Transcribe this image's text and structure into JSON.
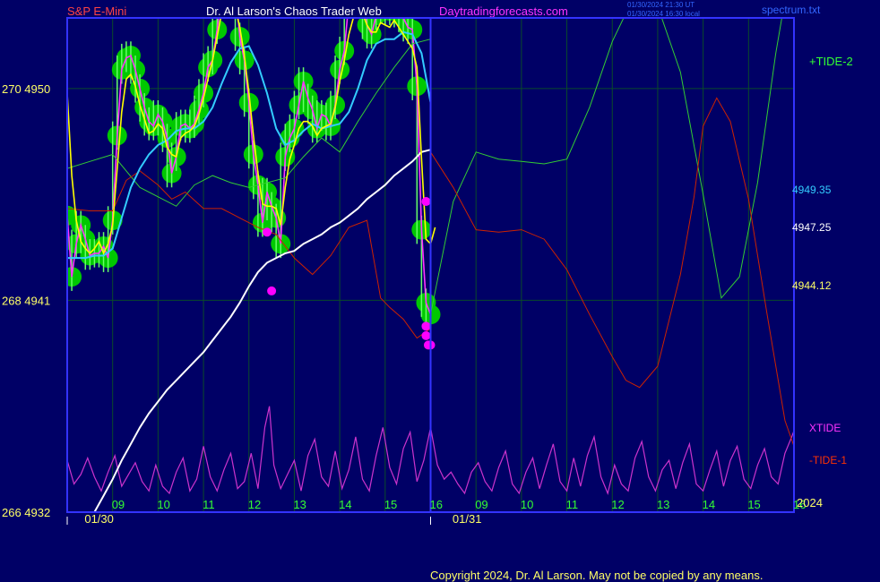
{
  "header": {
    "instrument": "S&P E-Mini",
    "site": "Dr. Al Larson's Chaos Trader Web",
    "url": "Daytradingforecasts.com",
    "stamp1": "01/30/2024 21:30 UT",
    "stamp2": "01/30/2024 16:30 local",
    "file": "spectrum.txt"
  },
  "footer": {
    "copyright": "Copyright 2024, Dr. Al Larson. May not be copied by any means."
  },
  "colors": {
    "background": "#000066",
    "frame": "#3333ff",
    "grid": "#0a4a2a",
    "price_glow": "#00c800",
    "price_bars": "#66ff66",
    "dots_green": "#00ff00",
    "dots_magenta": "#ff00ff",
    "fast_ma": "#ffff00",
    "cyan_ma": "#33ccff",
    "slow_ma": "#ffffff",
    "tide_plus": "#33cc33",
    "tide_minus": "#cc2200",
    "xtide": "#cc33cc",
    "magenta_line": "#ff33ff"
  },
  "chart_data": {
    "type": "line",
    "y_axis": {
      "range": [
        4932,
        4953
      ],
      "ticks": [
        {
          "value": 4950,
          "label": "270  4950"
        },
        {
          "value": 4941,
          "label": "268  4941"
        },
        {
          "value": 4932,
          "label": "266  4932"
        }
      ]
    },
    "x_axis": {
      "range": [
        8.0,
        24.0
      ],
      "hour_ticks": [
        {
          "x": 9,
          "label": "09"
        },
        {
          "x": 10,
          "label": "10"
        },
        {
          "x": 11,
          "label": "11"
        },
        {
          "x": 12,
          "label": "12"
        },
        {
          "x": 13,
          "label": "13"
        },
        {
          "x": 14,
          "label": "14"
        },
        {
          "x": 15,
          "label": "15"
        },
        {
          "x": 16,
          "label": "16"
        },
        {
          "x": 17,
          "label": "09"
        },
        {
          "x": 18,
          "label": "10"
        },
        {
          "x": 19,
          "label": "11"
        },
        {
          "x": 20,
          "label": "12"
        },
        {
          "x": 21,
          "label": "13"
        },
        {
          "x": 22,
          "label": "14"
        },
        {
          "x": 23,
          "label": "15"
        },
        {
          "x": 24,
          "label": "16"
        }
      ],
      "date_labels": [
        {
          "x": 8.5,
          "label": "01/30"
        },
        {
          "x": 16.6,
          "label": "01/31"
        }
      ],
      "year_label": "2024",
      "now_x": 16.0
    },
    "labels": {
      "tide_plus": "+TIDE-2",
      "tide_minus": "-TIDE-1",
      "xtide": "XTIDE",
      "value_cyan": "4949.35",
      "value_white": "4947.25",
      "value_yellow": "4944.12"
    },
    "price": {
      "x": [
        8.0,
        8.1,
        8.2,
        8.3,
        8.4,
        8.5,
        8.6,
        8.7,
        8.8,
        8.9,
        9.0,
        9.1,
        9.2,
        9.3,
        9.4,
        9.5,
        9.6,
        9.7,
        9.8,
        9.9,
        10.0,
        10.1,
        10.2,
        10.3,
        10.4,
        10.5,
        10.6,
        10.7,
        10.8,
        10.9,
        11.0,
        11.1,
        11.2,
        11.3,
        11.4,
        11.5,
        11.6,
        11.7,
        11.8,
        11.9,
        12.0,
        12.1,
        12.2,
        12.3,
        12.4,
        12.5,
        12.6,
        12.7,
        12.8,
        12.9,
        13.0,
        13.1,
        13.2,
        13.3,
        13.4,
        13.5,
        13.6,
        13.7,
        13.8,
        13.9,
        14.0,
        14.1,
        14.2,
        14.3,
        14.4,
        14.5,
        14.6,
        14.7,
        14.8,
        14.9,
        15.0,
        15.1,
        15.2,
        15.3,
        15.4,
        15.5,
        15.6,
        15.7,
        15.8,
        15.9,
        16.0
      ],
      "values": [
        4944.6,
        4942.0,
        4943.4,
        4944.2,
        4943.6,
        4942.9,
        4943.0,
        4943.0,
        4943.3,
        4942.8,
        4944.4,
        4948.0,
        4950.8,
        4951.3,
        4951.4,
        4950.8,
        4950.0,
        4949.2,
        4948.6,
        4948.4,
        4948.9,
        4948.6,
        4947.9,
        4946.4,
        4947.1,
        4948.4,
        4948.5,
        4948.3,
        4948.5,
        4949.1,
        4949.8,
        4950.9,
        4951.2,
        4952.5,
        4954.1,
        4954.7,
        4954.4,
        4954.3,
        4952.2,
        4951.2,
        4949.4,
        4947.2,
        4945.9,
        4944.3,
        4945.6,
        4945.0,
        4944.5,
        4943.4,
        4947.1,
        4947.9,
        4948.3,
        4949.3,
        4950.3,
        4949.6,
        4949.1,
        4948.3,
        4948.9,
        4948.8,
        4948.4,
        4949.3,
        4950.8,
        4951.6,
        4953.7,
        4954.2,
        4953.8,
        4953.6,
        4952.7,
        4952.3,
        4953.1,
        4953.4,
        4953.4,
        4953.3,
        4953.5,
        4953.2,
        4953.0,
        4952.6,
        4952.5,
        4950.1,
        4944.0,
        4940.9,
        4940.4
      ]
    },
    "fast_ma": {
      "x": [
        8.0,
        8.1,
        8.2,
        8.3,
        8.4,
        8.5,
        8.6,
        8.7,
        8.8,
        8.9,
        9.0,
        9.1,
        9.2,
        9.3,
        9.4,
        9.5,
        9.6,
        9.7,
        9.8,
        9.9,
        10.0,
        10.1,
        10.2,
        10.3,
        10.4,
        10.5,
        10.6,
        10.7,
        10.8,
        10.9,
        11.0,
        11.1,
        11.2,
        11.3,
        11.4,
        11.5,
        11.6,
        11.7,
        11.8,
        11.9,
        12.0,
        12.1,
        12.2,
        12.3,
        12.4,
        12.5,
        12.6,
        12.7,
        12.8,
        12.9,
        13.0,
        13.1,
        13.2,
        13.3,
        13.4,
        13.5,
        13.6,
        13.7,
        13.8,
        13.9,
        14.0,
        14.1,
        14.2,
        14.3,
        14.4,
        14.5,
        14.6,
        14.7,
        14.8,
        14.9,
        15.0,
        15.1,
        15.2,
        15.3,
        15.4,
        15.5,
        15.6,
        15.7,
        15.8,
        15.9,
        16.0,
        16.1
      ],
      "values": [
        4949.8,
        4946.3,
        4944.4,
        4943.5,
        4943.2,
        4943.0,
        4943.2,
        4943.5,
        4943.0,
        4943.4,
        4944.2,
        4946.6,
        4949.0,
        4950.4,
        4950.6,
        4950.1,
        4949.3,
        4948.7,
        4948.1,
        4948.2,
        4948.5,
        4948.3,
        4947.5,
        4947.2,
        4947.1,
        4947.9,
        4948.1,
        4948.2,
        4948.4,
        4948.9,
        4949.6,
        4950.4,
        4951.2,
        4952.2,
        4953.2,
        4953.6,
        4953.9,
        4953.4,
        4952.6,
        4951.4,
        4949.8,
        4948.0,
        4946.4,
        4945.1,
        4945.0,
        4945.0,
        4944.9,
        4944.2,
        4945.8,
        4947.0,
        4947.6,
        4948.3,
        4948.6,
        4948.6,
        4948.4,
        4948.0,
        4948.3,
        4948.4,
        4948.5,
        4949.2,
        4950.3,
        4951.2,
        4952.3,
        4953.0,
        4953.1,
        4953.2,
        4952.7,
        4952.4,
        4952.4,
        4952.8,
        4952.7,
        4952.6,
        4952.9,
        4952.6,
        4952.3,
        4952.0,
        4951.7,
        4950.9,
        4947.0,
        4943.6,
        4943.4,
        4944.1
      ]
    },
    "cyan_ma": {
      "x": [
        8.0,
        8.2,
        8.4,
        8.6,
        8.8,
        9.0,
        9.2,
        9.4,
        9.6,
        9.8,
        10.0,
        10.2,
        10.4,
        10.6,
        10.8,
        11.0,
        11.2,
        11.4,
        11.6,
        11.8,
        12.0,
        12.2,
        12.4,
        12.6,
        12.8,
        13.0,
        13.2,
        13.4,
        13.6,
        13.8,
        14.0,
        14.2,
        14.4,
        14.6,
        14.8,
        15.0,
        15.2,
        15.4,
        15.6,
        15.8,
        16.0
      ],
      "values": [
        4942.8,
        4942.8,
        4942.8,
        4942.9,
        4942.9,
        4943.2,
        4944.5,
        4945.8,
        4946.6,
        4947.2,
        4947.6,
        4947.8,
        4948.2,
        4948.3,
        4948.3,
        4948.6,
        4949.2,
        4950.2,
        4951.1,
        4951.7,
        4951.8,
        4951.0,
        4949.8,
        4948.3,
        4947.6,
        4947.8,
        4948.2,
        4948.5,
        4948.3,
        4948.4,
        4948.5,
        4949.0,
        4950.0,
        4951.2,
        4951.9,
        4952.1,
        4952.1,
        4952.4,
        4952.3,
        4951.5,
        4949.4
      ]
    },
    "slow_ma": {
      "x": [
        8.6,
        8.8,
        9.0,
        9.2,
        9.4,
        9.6,
        9.8,
        10.0,
        10.2,
        10.4,
        10.6,
        10.8,
        11.0,
        11.2,
        11.4,
        11.6,
        11.8,
        12.0,
        12.2,
        12.4,
        12.6,
        12.8,
        13.0,
        13.2,
        13.4,
        13.6,
        13.8,
        14.0,
        14.2,
        14.4,
        14.6,
        14.8,
        15.0,
        15.2,
        15.4,
        15.6,
        15.8,
        16.0
      ],
      "values": [
        4932.0,
        4932.7,
        4933.4,
        4934.2,
        4934.9,
        4935.6,
        4936.2,
        4936.7,
        4937.2,
        4937.6,
        4938.0,
        4938.4,
        4938.8,
        4939.3,
        4939.8,
        4940.3,
        4940.9,
        4941.6,
        4942.2,
        4942.6,
        4942.8,
        4943.0,
        4943.1,
        4943.4,
        4943.6,
        4943.8,
        4944.1,
        4944.3,
        4944.6,
        4944.9,
        4945.3,
        4945.6,
        4945.9,
        4946.3,
        4946.6,
        4946.9,
        4947.3,
        4947.4
      ]
    },
    "dots": {
      "green": [
        {
          "x": 12.0,
          "y": 4954.6
        },
        {
          "x": 12.2,
          "y": 4954.6
        },
        {
          "x": 12.4,
          "y": 4954.6
        },
        {
          "x": 14.9,
          "y": 4954.7
        },
        {
          "x": 15.4,
          "y": 4954.6
        },
        {
          "x": 15.6,
          "y": 4955.9
        },
        {
          "x": 15.7,
          "y": 4957.2
        }
      ],
      "magenta": [
        {
          "x": 12.4,
          "y": 4943.9
        },
        {
          "x": 12.5,
          "y": 4941.4
        },
        {
          "x": 15.9,
          "y": 4945.2
        },
        {
          "x": 15.9,
          "y": 4939.9
        },
        {
          "x": 15.9,
          "y": 4939.5
        },
        {
          "x": 15.95,
          "y": 4939.1
        },
        {
          "x": 16.0,
          "y": 4939.1
        }
      ]
    },
    "green_line": {
      "x": [
        8.0,
        8.5,
        9.0,
        9.3,
        9.6,
        10.0,
        10.4,
        10.8,
        11.2,
        11.6,
        12.0,
        12.4,
        12.8,
        13.2,
        13.6,
        14.0,
        14.4,
        14.8,
        15.2,
        15.6,
        16.0
      ],
      "values": [
        4946.6,
        4946.9,
        4947.2,
        4946.5,
        4945.8,
        4945.4,
        4945.0,
        4945.9,
        4946.3,
        4946.0,
        4945.8,
        4946.0,
        4946.2,
        4947.1,
        4947.9,
        4947.3,
        4948.6,
        4949.8,
        4950.9,
        4951.9,
        4952.1
      ]
    },
    "red_line": {
      "x": [
        8.0,
        8.5,
        9.0,
        9.3,
        9.6,
        10.0,
        10.3,
        10.6,
        11.0,
        11.4,
        11.8,
        12.2,
        12.6,
        13.0,
        13.4,
        13.8,
        14.2,
        14.6,
        14.9,
        15.1,
        15.4,
        15.7,
        16.0
      ],
      "values": [
        4944.9,
        4944.8,
        4944.8,
        4946.1,
        4946.5,
        4945.9,
        4945.3,
        4945.6,
        4944.9,
        4944.9,
        4944.5,
        4944.1,
        4943.8,
        4942.8,
        4942.1,
        4942.9,
        4944.1,
        4944.4,
        4941.1,
        4940.7,
        4940.2,
        4939.4,
        4939.8
      ]
    },
    "tide_plus_line": {
      "x": [
        16.0,
        16.5,
        17.0,
        17.5,
        18.0,
        18.5,
        19.0,
        19.5,
        20.0,
        20.5,
        21.0,
        21.5,
        22.0,
        22.4,
        22.8,
        23.2,
        23.6,
        24.0,
        24.1
      ],
      "values": [
        4940.4,
        4945.2,
        4947.3,
        4947.0,
        4946.9,
        4946.8,
        4947.0,
        4949.2,
        4952.0,
        4954.0,
        4953.5,
        4950.7,
        4945.5,
        4941.1,
        4942.0,
        4946.0,
        4951.5,
        4956.0,
        4957.0
      ]
    },
    "tide_minus_line": {
      "x": [
        16.0,
        16.5,
        17.0,
        17.5,
        18.0,
        18.5,
        19.0,
        19.5,
        20.0,
        20.3,
        20.6,
        21.0,
        21.5,
        21.8,
        22.0,
        22.3,
        22.6,
        23.0,
        23.4,
        23.8,
        24.0,
        24.1
      ],
      "values": [
        4947.3,
        4945.8,
        4944.0,
        4943.9,
        4944.0,
        4943.6,
        4942.3,
        4940.4,
        4938.6,
        4937.6,
        4937.3,
        4938.2,
        4942.1,
        4945.4,
        4948.4,
        4949.6,
        4948.6,
        4945.3,
        4940.5,
        4935.9,
        4934.8,
        4934.7
      ]
    },
    "xtide_line": {
      "x": [
        8.0,
        8.15,
        8.3,
        8.45,
        8.6,
        8.75,
        8.9,
        9.05,
        9.2,
        9.35,
        9.5,
        9.65,
        9.8,
        9.95,
        10.1,
        10.25,
        10.4,
        10.55,
        10.7,
        10.85,
        11.0,
        11.15,
        11.3,
        11.45,
        11.6,
        11.75,
        11.9,
        12.05,
        12.2,
        12.35,
        12.45,
        12.55,
        12.7,
        12.85,
        13.0,
        13.15,
        13.3,
        13.45,
        13.6,
        13.75,
        13.9,
        14.05,
        14.2,
        14.35,
        14.5,
        14.65,
        14.8,
        14.95,
        15.1,
        15.25,
        15.4,
        15.55,
        15.7,
        15.85,
        16.0,
        16.15,
        16.3,
        16.45,
        16.6,
        16.75,
        16.9,
        17.05,
        17.2,
        17.35,
        17.5,
        17.65,
        17.8,
        17.95,
        18.1,
        18.25,
        18.4,
        18.55,
        18.7,
        18.85,
        19.0,
        19.15,
        19.3,
        19.45,
        19.6,
        19.75,
        19.9,
        20.05,
        20.2,
        20.35,
        20.5,
        20.65,
        20.8,
        20.95,
        21.1,
        21.25,
        21.4,
        21.55,
        21.7,
        21.85,
        22.0,
        22.15,
        22.3,
        22.45,
        22.6,
        22.75,
        22.9,
        23.05,
        23.2,
        23.35,
        23.5,
        23.65,
        23.8,
        23.95,
        24.1
      ],
      "values": [
        4934.2,
        4933.2,
        4933.6,
        4934.3,
        4933.5,
        4932.9,
        4933.7,
        4934.4,
        4933.1,
        4933.6,
        4934.1,
        4933.3,
        4932.9,
        4934.0,
        4933.1,
        4932.8,
        4933.7,
        4934.3,
        4932.9,
        4933.4,
        4934.8,
        4933.5,
        4932.9,
        4933.8,
        4934.5,
        4933.0,
        4933.3,
        4934.5,
        4933.0,
        4935.6,
        4936.5,
        4934.0,
        4933.0,
        4933.6,
        4934.2,
        4932.9,
        4934.4,
        4935.1,
        4933.5,
        4933.1,
        4934.6,
        4933.0,
        4933.8,
        4935.2,
        4933.4,
        4932.9,
        4934.4,
        4935.6,
        4933.9,
        4933.2,
        4934.7,
        4935.4,
        4933.3,
        4934.2,
        4935.6,
        4934.0,
        4933.4,
        4933.7,
        4933.2,
        4932.8,
        4933.7,
        4934.1,
        4933.3,
        4932.9,
        4933.9,
        4934.6,
        4933.2,
        4932.8,
        4933.7,
        4934.3,
        4933.0,
        4934.0,
        4934.9,
        4933.3,
        4932.9,
        4934.3,
        4933.1,
        4934.4,
        4935.2,
        4933.5,
        4932.8,
        4934.0,
        4933.2,
        4932.9,
        4934.3,
        4935.0,
        4933.5,
        4932.9,
        4933.8,
        4934.2,
        4933.0,
        4934.1,
        4934.9,
        4933.2,
        4932.9,
        4933.8,
        4934.6,
        4933.1,
        4934.2,
        4934.8,
        4933.4,
        4933.0,
        4934.0,
        4934.7,
        4933.5,
        4933.2,
        4934.5,
        4935.2,
        4936.0
      ]
    }
  }
}
